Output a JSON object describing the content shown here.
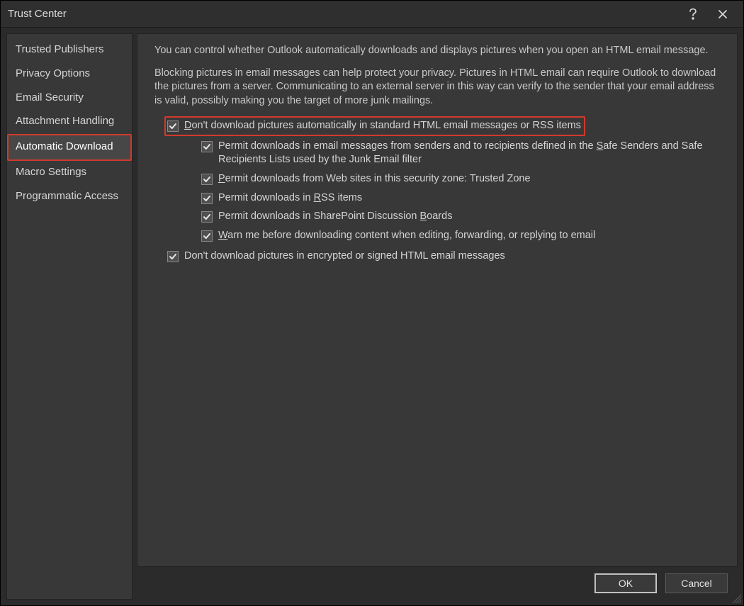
{
  "window": {
    "title": "Trust Center"
  },
  "sidebar": {
    "items": [
      {
        "label": "Trusted Publishers",
        "selected": false
      },
      {
        "label": "Privacy Options",
        "selected": false
      },
      {
        "label": "Email Security",
        "selected": false
      },
      {
        "label": "Attachment Handling",
        "selected": false
      },
      {
        "label": "Automatic Download",
        "selected": true,
        "highlighted": true
      },
      {
        "label": "Macro Settings",
        "selected": false
      },
      {
        "label": "Programmatic Access",
        "selected": false
      }
    ]
  },
  "content": {
    "intro1": "You can control whether Outlook automatically downloads and displays pictures when you open an HTML email message.",
    "intro2": "Blocking pictures in email messages can help protect your privacy. Pictures in HTML email can require Outlook to download the pictures from a server. Communicating to an external server in this way can verify to the sender that your email address is valid, possibly making you the target of more junk mailings.",
    "opt_main": {
      "pre": "",
      "u": "D",
      "post": "on't download pictures automatically in standard HTML email messages or RSS items",
      "checked": true,
      "highlighted": true
    },
    "subs": [
      {
        "pre": "Permit downloads in email messages from senders and to recipients defined in the ",
        "u": "S",
        "post": "afe Senders and Safe Recipients Lists used by the Junk Email filter",
        "checked": true
      },
      {
        "pre": "",
        "u": "P",
        "post": "ermit downloads from Web sites in this security zone: Trusted Zone",
        "checked": true
      },
      {
        "pre": "Permit downloads in ",
        "u": "R",
        "post": "SS items",
        "checked": true
      },
      {
        "pre": "Permit downloads in SharePoint Discussion ",
        "u": "B",
        "post": "oards",
        "checked": true
      },
      {
        "pre": "",
        "u": "W",
        "post": "arn me before downloading content when editing, forwarding, or replying to email",
        "checked": true
      }
    ],
    "opt_encrypted": {
      "pre": "Don't download pictures in encrypted or signed HTML email messages",
      "u": "",
      "post": "",
      "checked": true
    }
  },
  "footer": {
    "ok": "OK",
    "cancel": "Cancel"
  }
}
